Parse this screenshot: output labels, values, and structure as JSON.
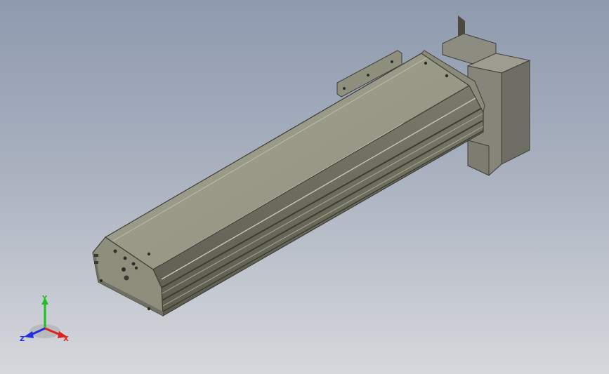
{
  "viewport": {
    "background_top": "#8e9aae",
    "background_bottom": "#d6d8dc"
  },
  "model": {
    "part_color": "#8a8a78",
    "part_dark": "#5f5f52",
    "part_light": "#b3b3a2",
    "motor_color": "#7f7f74"
  },
  "triad": {
    "x_label": "X",
    "y_label": "Y",
    "z_label": "Z",
    "x_color": "#e02020",
    "y_color": "#20c020",
    "z_color": "#2030e0"
  }
}
